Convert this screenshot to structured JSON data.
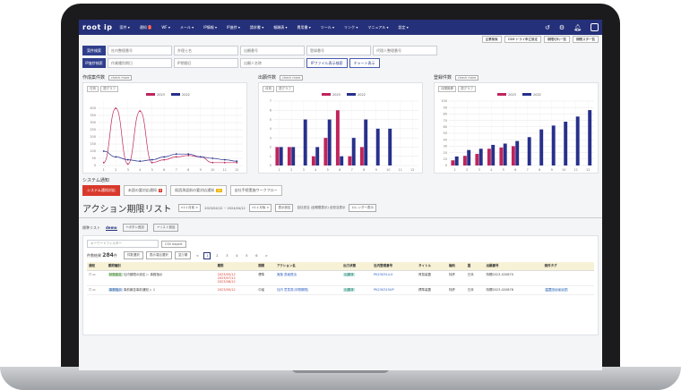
{
  "nav": {
    "logo": "root ip",
    "items": [
      "案件 ▾",
      "通知",
      "WF ▾",
      "メール ▾",
      "IP情報 ▾",
      "IP進捗 ▾",
      "請求書 ▾",
      "報酬表 ▾",
      "費用書 ▾",
      "ツール ▾",
      "リンク ▾",
      "マニュアル ▾",
      "設定 ▾"
    ],
    "notify_count": "1",
    "icons": [
      "history-icon",
      "gear-icon",
      "bell-icon",
      "user-icon"
    ]
  },
  "subbar": [
    "企業検索",
    "CSM ドライ申立設定",
    "期限切れ一覧",
    "期間スタ一覧"
  ],
  "filters": {
    "row1_label": "案件検索",
    "row1": [
      "社内整理番号",
      "弁理士名",
      "出願番号",
      "登録番号",
      "代理人整理番号"
    ],
    "row2_label": "IP進捗検索",
    "row2": [
      "作業種別期日",
      "IP期間日",
      "出願人名称"
    ],
    "row2_buttons": [
      "IPファイル表示検索",
      "チャート表示"
    ]
  },
  "charts": [
    {
      "title": "作成案件数",
      "check": "check more",
      "tabs": [
        "日別",
        "週グラフ"
      ]
    },
    {
      "title": "出願件数",
      "check": "check more",
      "tabs": [
        "月別",
        "週グラフ"
      ]
    },
    {
      "title": "登録件数",
      "check": "check more",
      "tabs": [
        "月間推移",
        "週グラフ"
      ]
    }
  ],
  "chart_data": [
    {
      "type": "line",
      "x": [
        1,
        2,
        3,
        4,
        5,
        6,
        7,
        8,
        9,
        10,
        11,
        12
      ],
      "series": [
        {
          "name": "2023",
          "values": [
            20,
            400,
            10,
            380,
            20,
            40,
            60,
            70,
            60,
            20,
            20,
            20
          ]
        },
        {
          "name": "2022",
          "values": [
            100,
            60,
            40,
            30,
            40,
            60,
            80,
            80,
            60,
            50,
            40,
            30
          ]
        }
      ],
      "yticks": [
        0,
        50,
        100,
        150,
        200,
        250,
        300,
        350,
        400
      ],
      "ylim": [
        0,
        450
      ],
      "colors": {
        "2023": "#c0245c",
        "2022": "#27308c"
      }
    },
    {
      "type": "bar",
      "x": [
        1,
        2,
        3,
        4,
        5,
        6,
        7,
        8,
        9,
        10,
        11,
        12
      ],
      "series": [
        {
          "name": "2023",
          "values": [
            2,
            2,
            0,
            1,
            3,
            6,
            1,
            2,
            0,
            0,
            0,
            0
          ]
        },
        {
          "name": "2022",
          "values": [
            2,
            2,
            5,
            2,
            5,
            1,
            3,
            5,
            4,
            4,
            0,
            0
          ]
        }
      ],
      "yticks": [
        0,
        1,
        2,
        3,
        4,
        5,
        6,
        7
      ],
      "ylim": [
        0,
        7
      ],
      "colors": {
        "2023": "#c0245c",
        "2022": "#27308c"
      }
    },
    {
      "type": "bar",
      "x": [
        1,
        2,
        3,
        4,
        5,
        6,
        7,
        8,
        9,
        10,
        11,
        12
      ],
      "series": [
        {
          "name": "2023",
          "values": [
            8,
            15,
            18,
            26,
            28,
            30,
            0,
            0,
            0,
            0,
            0,
            0
          ]
        },
        {
          "name": "2022",
          "values": [
            14,
            24,
            26,
            32,
            34,
            38,
            44,
            56,
            62,
            68,
            76,
            86
          ]
        }
      ],
      "yticks": [
        0,
        10,
        20,
        30,
        40,
        50,
        60,
        70,
        80,
        90,
        100
      ],
      "ylim": [
        0,
        100
      ],
      "colors": {
        "2023": "#c0245c",
        "2022": "#27308c"
      }
    }
  ],
  "system": {
    "title": "システム通知",
    "buttons": [
      {
        "label": "システム通知対応",
        "badge": ""
      },
      {
        "label": "未読の要対応通知",
        "badge": "5"
      },
      {
        "label": "既読承認前の要対応通知",
        "badge": "14"
      },
      {
        "label": "自社手続実施ワークフロー",
        "badge": ""
      }
    ]
  },
  "action": {
    "title": "アクション期限リスト",
    "chips": [
      "<1ヶ月前 >",
      "2023/04/12 ~ 2024/04/12",
      "<1ヶ月後 >",
      "表示設定"
    ],
    "text": "自社担当 (全期限表示) 全担当表示",
    "extra_btn": "カレンダー表示",
    "tabs": [
      "標準リスト",
      "demo",
      "+ボタン追加",
      "+リスト追加"
    ],
    "keyword_placeholder": "キーワードフィルター",
    "csv_btn": "CSV export",
    "count_label": "件数結果",
    "count": "284",
    "count_unit": "件",
    "toolbar": [
      "件数選択",
      "表示項目選択",
      "並び順"
    ],
    "pages": [
      "<",
      "1",
      "2",
      "3",
      "4",
      "5",
      "6",
      ">"
    ],
    "columns": [
      "通知",
      "期限種別",
      "期限",
      "期間",
      "アクション名",
      "出力状態",
      "社内整理番号",
      "タイトル",
      "権利",
      "国",
      "出願番号",
      "案件タグ"
    ],
    "rows": [
      {
        "tag": "状態設定",
        "kind": "社内期限の設定 ▷ 事務指示",
        "dates": [
          "2023/05/12",
          "2023/07/12",
          "2023/08/12"
        ],
        "period": "標準",
        "action": "実施 書面提出",
        "state": "出願済",
        "docno": "PK230314-0",
        "title": "貿易装置",
        "right": "特許",
        "country": "日本",
        "appno": "特開2023-020870",
        "case_tag": ""
      },
      {
        "tag": "事務指示",
        "kind": "事前報告事前通知 ▷ 1",
        "dates": [
          "2023/05/12"
        ],
        "period": "中省",
        "action": "社内 意見書(中間期限)",
        "state": "出願済",
        "docno": "PK230315UP",
        "title": "標準装置",
        "right": "特許",
        "country": "日本",
        "appno": "特開2023-020876",
        "case_tag": "注意ランキング"
      }
    ]
  }
}
